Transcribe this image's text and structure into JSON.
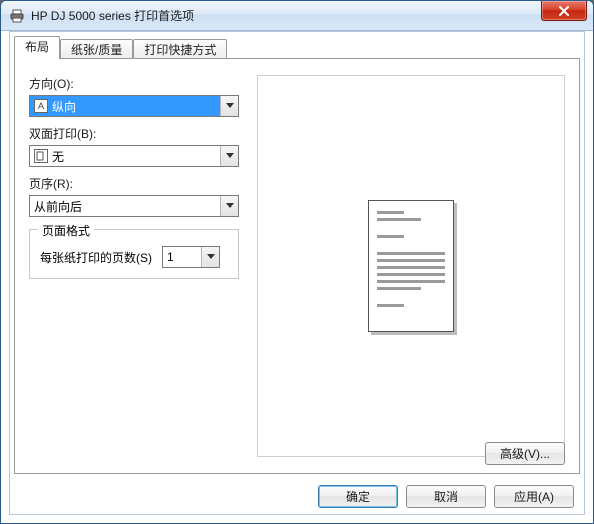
{
  "window": {
    "title": "HP DJ 5000 series 打印首选项"
  },
  "tabs": [
    {
      "label": "布局"
    },
    {
      "label": "纸张/质量"
    },
    {
      "label": "打印快捷方式"
    }
  ],
  "layout": {
    "orientation_label": "方向(O):",
    "orientation_value": "纵向",
    "duplex_label": "双面打印(B):",
    "duplex_value": "无",
    "pageorder_label": "页序(R):",
    "pageorder_value": "从前向后",
    "pageformat_legend": "页面格式",
    "pps_label": "每张纸打印的页数(S)",
    "pps_value": "1",
    "advanced_btn": "高级(V)..."
  },
  "buttons": {
    "ok": "确定",
    "cancel": "取消",
    "apply": "应用(A)"
  }
}
